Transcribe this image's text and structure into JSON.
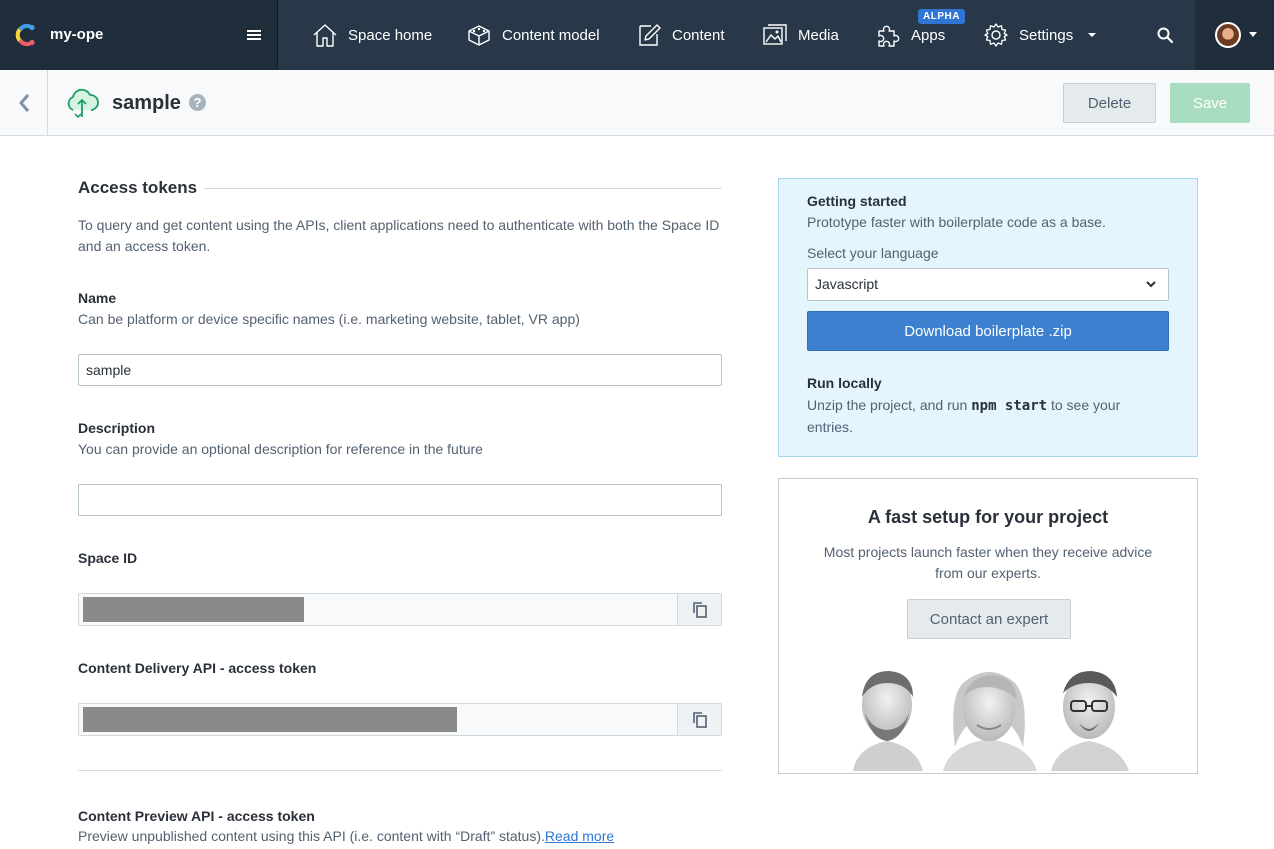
{
  "topnav": {
    "space_name": "my-ope",
    "items": [
      {
        "label": "Space home",
        "icon": "home-icon"
      },
      {
        "label": "Content model",
        "icon": "content-model-icon"
      },
      {
        "label": "Content",
        "icon": "content-edit-icon"
      },
      {
        "label": "Media",
        "icon": "media-icon"
      },
      {
        "label": "Apps",
        "icon": "puzzle-icon"
      },
      {
        "label": "Settings",
        "icon": "gear-icon"
      }
    ],
    "apps_badge": "ALPHA"
  },
  "header": {
    "title": "sample",
    "help": "?",
    "delete_label": "Delete",
    "save_label": "Save"
  },
  "access_tokens": {
    "title": "Access tokens",
    "intro": "To query and get content using the APIs, client applications need to authenticate with both the Space ID and an access token.",
    "name": {
      "label": "Name",
      "help": "Can be platform or device specific names (i.e. marketing website, tablet, VR app)",
      "value": "sample"
    },
    "description": {
      "label": "Description",
      "help": "You can provide an optional description for reference in the future",
      "value": ""
    },
    "space_id": {
      "label": "Space ID"
    },
    "cda_token": {
      "label": "Content Delivery API - access token"
    },
    "cpa_token": {
      "label": "Content Preview API - access token",
      "help": "Preview unpublished content using this API (i.e. content with “Draft” status).",
      "link": "Read more"
    }
  },
  "getting_started": {
    "title": "Getting started",
    "subtitle": "Prototype faster with boilerplate code as a base.",
    "language_label": "Select your language",
    "language_value": "Javascript",
    "download_label": "Download boilerplate .zip",
    "run_title": "Run locally",
    "run_pre": "Unzip the project, and run ",
    "run_code": "npm start",
    "run_post": " to see your entries."
  },
  "expert": {
    "title": "A fast setup for your project",
    "description": "Most projects launch faster when they receive advice from our experts.",
    "button_label": "Contact an expert"
  },
  "colors": {
    "nav_bg": "#283848",
    "accent_blue": "#3c80cf",
    "save_disabled": "#a7dcc0",
    "info_bg": "#e5f5fd"
  }
}
